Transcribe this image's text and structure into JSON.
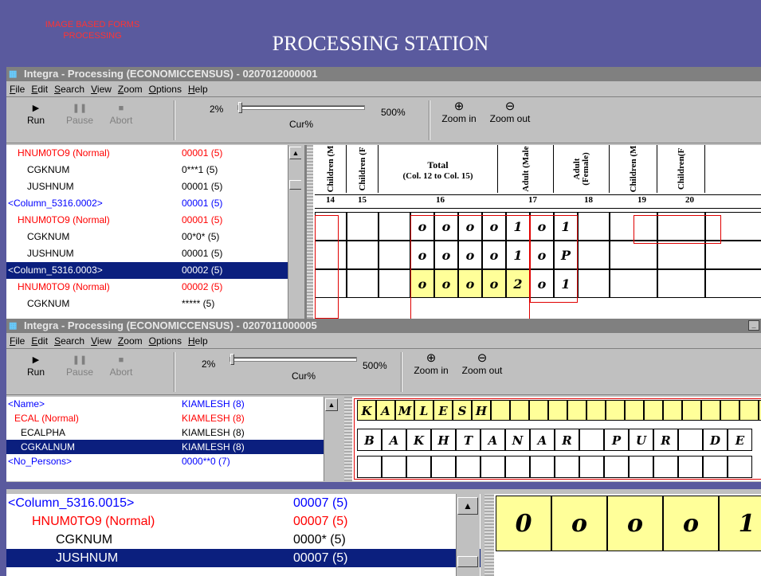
{
  "slide": {
    "corner_label_line1": "IMAGE BASED FORMS",
    "corner_label_line2": "PROCESSING",
    "title": "PROCESSING STATION"
  },
  "window1": {
    "title": "Integra - Processing (ECONOMICCENSUS) - 0207012000001",
    "menu": [
      "File",
      "Edit",
      "Search",
      "View",
      "Zoom",
      "Options",
      "Help"
    ],
    "toolbar": {
      "run": "Run",
      "pause": "Pause",
      "abort": "Abort",
      "zoom_min": "2%",
      "zoom_max": "500%",
      "cur_label": "Cur%",
      "zoom_in": "Zoom in",
      "zoom_out": "Zoom out"
    },
    "tree": [
      {
        "key": "HNUM0TO9 (Normal)",
        "value": "00001 (5)",
        "color": "red",
        "indent": 1
      },
      {
        "key": "CGKNUM",
        "value": "0***1 (5)",
        "color": "blk",
        "indent": 2
      },
      {
        "key": "JUSHNUM",
        "value": "00001 (5)",
        "color": "blk",
        "indent": 2
      },
      {
        "key": "<Column_5316.0002>",
        "value": "00001 (5)",
        "color": "blue",
        "indent": 0
      },
      {
        "key": "HNUM0TO9 (Normal)",
        "value": "00001 (5)",
        "color": "red",
        "indent": 1
      },
      {
        "key": "CGKNUM",
        "value": "00*0* (5)",
        "color": "blk",
        "indent": 2
      },
      {
        "key": "JUSHNUM",
        "value": "00001 (5)",
        "color": "blk",
        "indent": 2
      },
      {
        "key": "<Column_5316.0003>",
        "value": "00002 (5)",
        "color": "blue",
        "indent": 0,
        "selected": true
      },
      {
        "key": "HNUM0TO9 (Normal)",
        "value": "00002 (5)",
        "color": "red",
        "indent": 1
      },
      {
        "key": "CGKNUM",
        "value": "***** (5)",
        "color": "blk",
        "indent": 2
      }
    ],
    "form": {
      "headers": [
        "Children (M",
        "Children (F",
        "Total",
        "(Col. 12 to Col. 15)",
        "Adult (Male",
        "Adult (Female)",
        "Children (M",
        "Children(F"
      ],
      "col_numbers": [
        "14",
        "15",
        "16",
        "17",
        "18",
        "19",
        "20"
      ],
      "rows": [
        [
          "o",
          "o",
          "o",
          "o",
          "1",
          "o",
          "1"
        ],
        [
          "o",
          "o",
          "o",
          "o",
          "1",
          "o",
          "P"
        ],
        [
          "o",
          "o",
          "o",
          "o",
          "2",
          "o",
          "1"
        ]
      ]
    }
  },
  "window2": {
    "title": "Integra - Processing (ECONOMICCENSUS) - 0207011000005",
    "menu": [
      "File",
      "Edit",
      "Search",
      "View",
      "Zoom",
      "Options",
      "Help"
    ],
    "toolbar": {
      "run": "Run",
      "pause": "Pause",
      "abort": "Abort",
      "zoom_min": "2%",
      "zoom_max": "500%",
      "cur_label": "Cur%",
      "zoom_in": "Zoom in",
      "zoom_out": "Zoom out"
    },
    "tree": [
      {
        "key": "<Name>",
        "value": "KIAMLESH (8)",
        "color": "blue",
        "indent": 0
      },
      {
        "key": "ECAL (Normal)",
        "value": "KIAMLESH (8)",
        "color": "red",
        "indent": 1
      },
      {
        "key": "ECALPHA",
        "value": "KIAMLESH (8)",
        "color": "blk",
        "indent": 2
      },
      {
        "key": "CGKALNUM",
        "value": "KIAMLESH (8)",
        "color": "blk",
        "indent": 2,
        "selected": true
      },
      {
        "key": "<No_Persons>",
        "value": "0000**0 (7)",
        "color": "blue",
        "indent": 0
      }
    ],
    "form": {
      "row1": [
        "K",
        "A",
        "M",
        "L",
        "E",
        "S",
        "H"
      ],
      "row2": [
        "B",
        "A",
        "K",
        "H",
        "T",
        "A",
        "N",
        "A",
        "R",
        "",
        "P",
        "U",
        "R",
        "",
        "D",
        "E"
      ]
    }
  },
  "zoomed": {
    "tree": [
      {
        "key": "<Column_5316.0015>",
        "value": "00007 (5)",
        "color": "blue",
        "indent": 0
      },
      {
        "key": "HNUM0TO9 (Normal)",
        "value": "00007 (5)",
        "color": "red",
        "indent": 1
      },
      {
        "key": "CGKNUM",
        "value": "0000* (5)",
        "color": "blk",
        "indent": 2
      },
      {
        "key": "JUSHNUM",
        "value": "00007 (5)",
        "color": "blk",
        "indent": 2,
        "selected": true
      }
    ],
    "form_row": [
      "0",
      "o",
      "o",
      "o",
      "1"
    ]
  }
}
